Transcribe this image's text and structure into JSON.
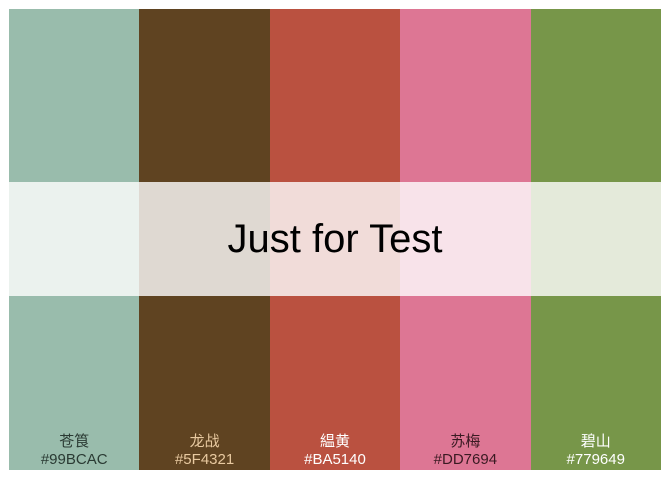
{
  "caption": "Just for Test",
  "swatches": [
    {
      "name": "苍筤",
      "hex": "#99BCAC",
      "color": "#99BCAC",
      "text_color": "#2a3a33"
    },
    {
      "name": "龙战",
      "hex": "#5F4321",
      "color": "#5F4321",
      "text_color": "#e8c9a0"
    },
    {
      "name": "緼黄",
      "hex": "#BA5140",
      "color": "#BA5140",
      "text_color": "#ffffff"
    },
    {
      "name": "苏梅",
      "hex": "#DD7694",
      "color": "#DD7694",
      "text_color": "#3a1a22"
    },
    {
      "name": "碧山",
      "hex": "#779649",
      "color": "#779649",
      "text_color": "#ffffff"
    }
  ]
}
